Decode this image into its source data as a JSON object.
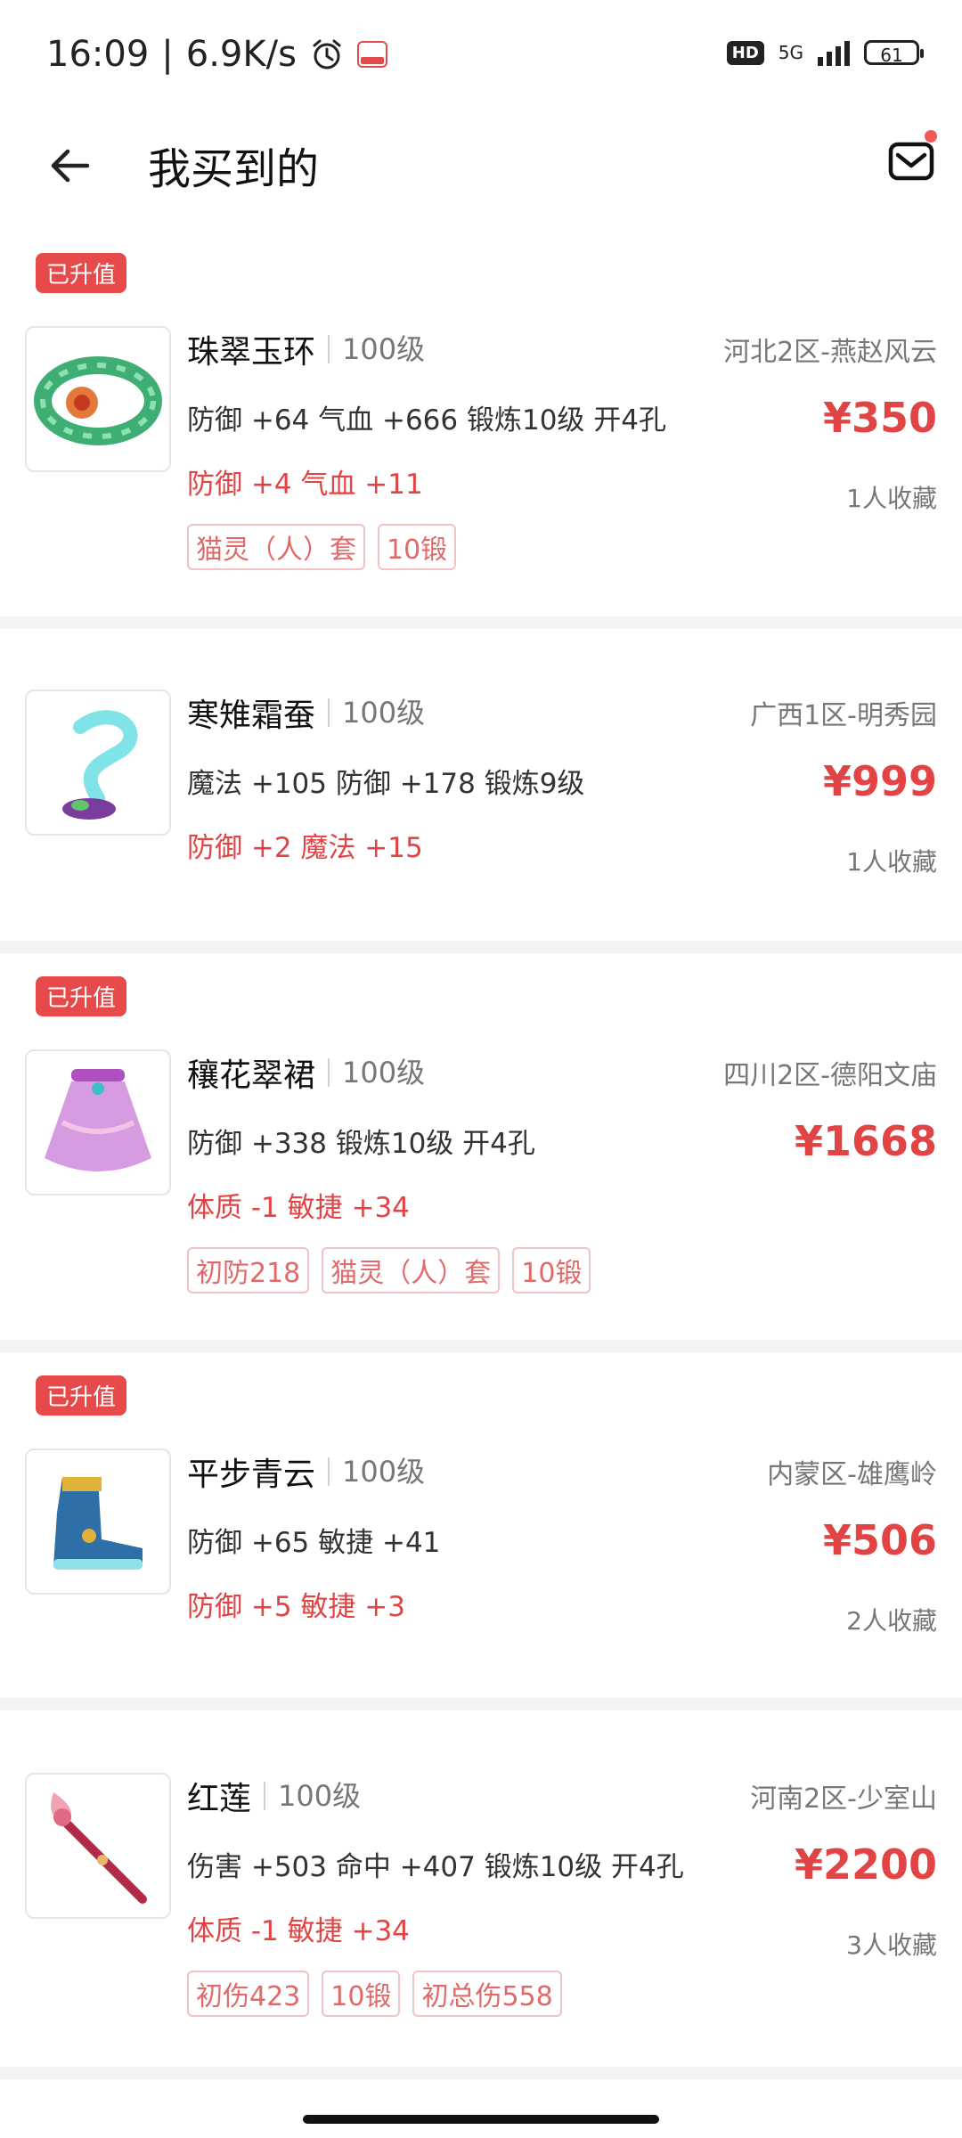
{
  "status_bar": {
    "time": "16:09",
    "speed": "6.9K/s",
    "hd": "HD",
    "network": "5G",
    "battery": "61"
  },
  "header": {
    "title": "我买到的"
  },
  "items": [
    {
      "badge": "已升值",
      "name": "珠翠玉环",
      "level": "100级",
      "server": "河北2区-燕赵风云",
      "stats": "防御 +64 气血 +666 锻炼10级 开4孔",
      "price": "¥350",
      "bonus": "防御 +4 气血 +11",
      "favorites": "1人收藏",
      "tags": [
        "猫灵（人）套",
        "10锻"
      ]
    },
    {
      "badge": "",
      "name": "寒雉霜蚕",
      "level": "100级",
      "server": "广西1区-明秀园",
      "stats": "魔法 +105 防御 +178 锻炼9级",
      "price": "¥999",
      "bonus": "防御 +2 魔法 +15",
      "favorites": "1人收藏",
      "tags": []
    },
    {
      "badge": "已升值",
      "name": "穰花翠裙",
      "level": "100级",
      "server": "四川2区-德阳文庙",
      "stats": "防御 +338 锻炼10级 开4孔",
      "price": "¥1668",
      "bonus": "体质 -1 敏捷 +34",
      "favorites": "",
      "tags": [
        "初防218",
        "猫灵（人）套",
        "10锻"
      ]
    },
    {
      "badge": "已升值",
      "name": "平步青云",
      "level": "100级",
      "server": "内蒙区-雄鹰岭",
      "stats": "防御 +65 敏捷 +41",
      "price": "¥506",
      "bonus": "防御 +5 敏捷 +3",
      "favorites": "2人收藏",
      "tags": []
    },
    {
      "badge": "",
      "name": "红莲",
      "level": "100级",
      "server": "河南2区-少室山",
      "stats": "伤害 +503 命中 +407 锻炼10级 开4孔",
      "price": "¥2200",
      "bonus": "体质 -1 敏捷 +34",
      "favorites": "3人收藏",
      "tags": [
        "初伤423",
        "10锻",
        "初总伤558"
      ]
    }
  ],
  "icons": {
    "back": "arrow-left-icon",
    "mail": "mail-icon",
    "alarm": "alarm-icon"
  },
  "colors": {
    "accent_red": "#e04444",
    "badge_red": "#e64a4a"
  }
}
